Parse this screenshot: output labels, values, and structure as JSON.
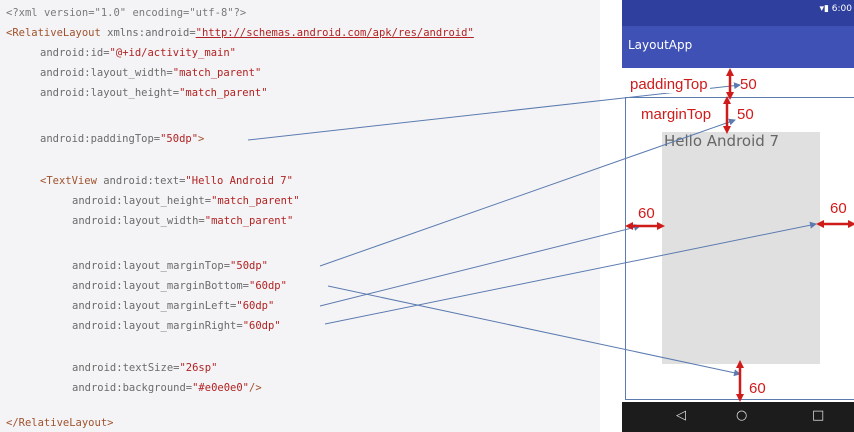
{
  "code": {
    "xml_decl_start": "<?xml ",
    "xml_decl_attrs": "version=\"1.0\" encoding=\"utf-8\"?>",
    "relative_open": "<RelativeLayout",
    "xmlns_attr": " xmlns:android=",
    "xmlns_url": "\"http://schemas.android.com/apk/res/android\"",
    "id_attr": "android:id=",
    "id_value": "\"@+id/activity_main\"",
    "lw_attr": "android:layout_width=",
    "lw_value": "\"match_parent\"",
    "lh_attr": "android:layout_height=",
    "lh_value": "\"match_parent\"",
    "padding_attr": "android:paddingTop=",
    "padding_value": "\"50dp\"",
    "padding_close": ">",
    "textview_open": "<TextView",
    "text_attr": " android:text=",
    "text_value": "\"Hello Android 7\"",
    "tv_lh_attr": "android:layout_height=",
    "tv_lh_value": "\"match_parent\"",
    "tv_lw_attr": "android:layout_width=",
    "tv_lw_value": "\"match_parent\"",
    "mt_attr": "android:layout_marginTop=",
    "mt_value": "\"50dp\"",
    "mb_attr": "android:layout_marginBottom=",
    "mb_value": "\"60dp\"",
    "ml_attr": "android:layout_marginLeft=",
    "ml_value": "\"60dp\"",
    "mr_attr": "android:layout_marginRight=",
    "mr_value": "\"60dp\"",
    "ts_attr": "android:textSize=",
    "ts_value": "\"26sp\"",
    "bg_attr": "android:background=",
    "bg_value": "\"#e0e0e0\"",
    "bg_close": "/>",
    "relative_close": "</RelativeLayout>"
  },
  "phone": {
    "status_time": "▾▮ 6:00",
    "app_title": "LayoutApp",
    "textview_text": "Hello Android 7",
    "nav_back": "◁",
    "nav_home": "○",
    "nav_recent": "□"
  },
  "annotations": {
    "padding_top_label": "paddingTop",
    "padding_top_value": "50",
    "margin_top_label": "marginTop",
    "margin_top_value": "50",
    "margin_left_value": "60",
    "margin_right_value": "60",
    "margin_bottom_value": "60"
  },
  "colors": {
    "annotation_red": "#d01b1b",
    "connector_blue": "#5b7bb0",
    "toolbar": "#3f51b5",
    "statusbar": "#2f3f9e",
    "textview_bg": "#e0e0e0"
  }
}
